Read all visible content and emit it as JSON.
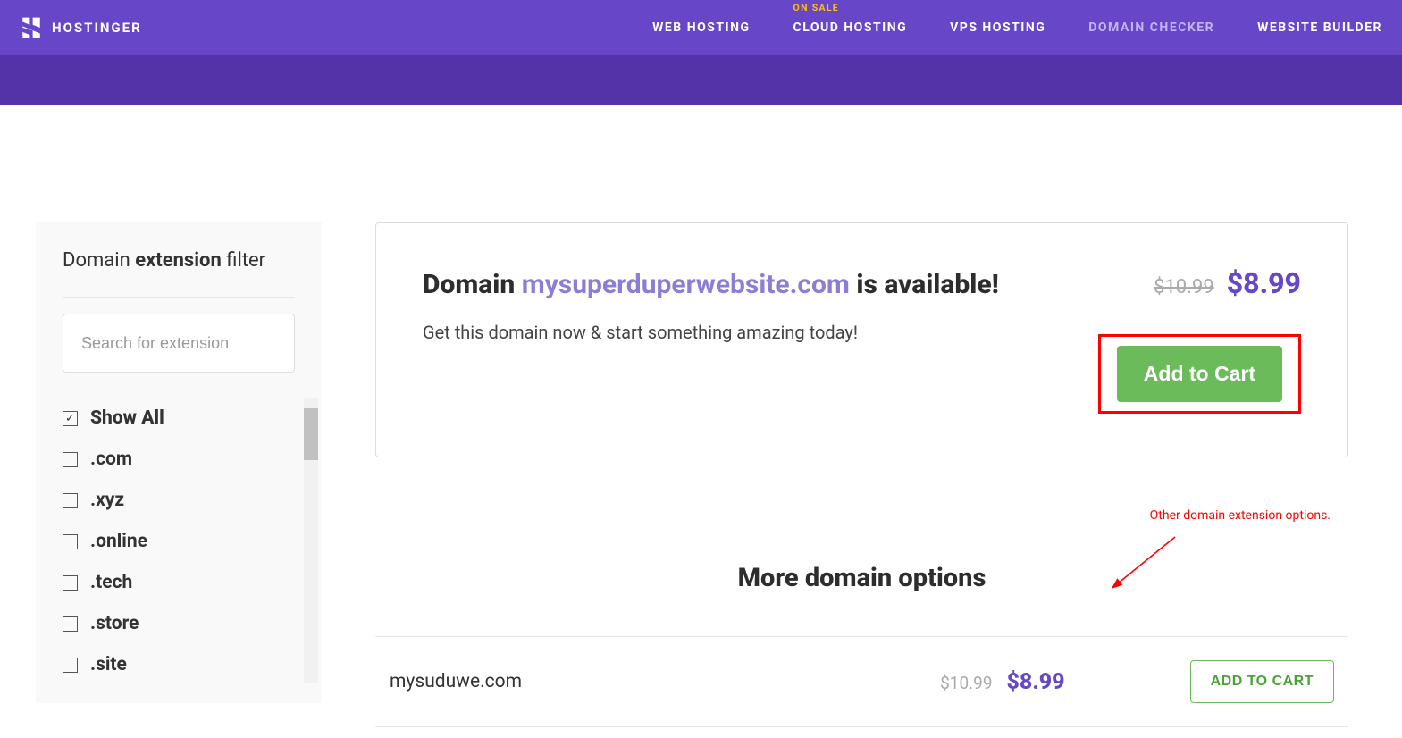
{
  "header": {
    "brand": "HOSTINGER",
    "nav": [
      {
        "label": "WEB HOSTING",
        "badge": ""
      },
      {
        "label": "CLOUD HOSTING",
        "badge": "ON SALE"
      },
      {
        "label": "VPS HOSTING",
        "badge": ""
      },
      {
        "label": "DOMAIN CHECKER",
        "badge": "",
        "dimmed": true
      },
      {
        "label": "WEBSITE BUILDER",
        "badge": ""
      }
    ]
  },
  "sidebar": {
    "title_light1": "Domain ",
    "title_bold": "extension",
    "title_light2": " filter",
    "search_placeholder": "Search for extension",
    "items": [
      {
        "label": "Show All",
        "checked": true
      },
      {
        "label": ".com",
        "checked": false
      },
      {
        "label": ".xyz",
        "checked": false
      },
      {
        "label": ".online",
        "checked": false
      },
      {
        "label": ".tech",
        "checked": false
      },
      {
        "label": ".store",
        "checked": false
      },
      {
        "label": ".site",
        "checked": false
      }
    ]
  },
  "result": {
    "prefix": "Domain ",
    "domain": "mysuperduperwebsite.com",
    "suffix": " is available!",
    "subline": "Get this domain now & start something amazing today!",
    "old_price": "$10.99",
    "new_price": "$8.99",
    "cta": "Add to Cart"
  },
  "more": {
    "heading": "More domain options",
    "annotation": "Other domain extension options.",
    "rows": [
      {
        "domain": "mysuduwe.com",
        "old": "$10.99",
        "new": "$8.99",
        "cta": "ADD TO CART"
      }
    ]
  }
}
